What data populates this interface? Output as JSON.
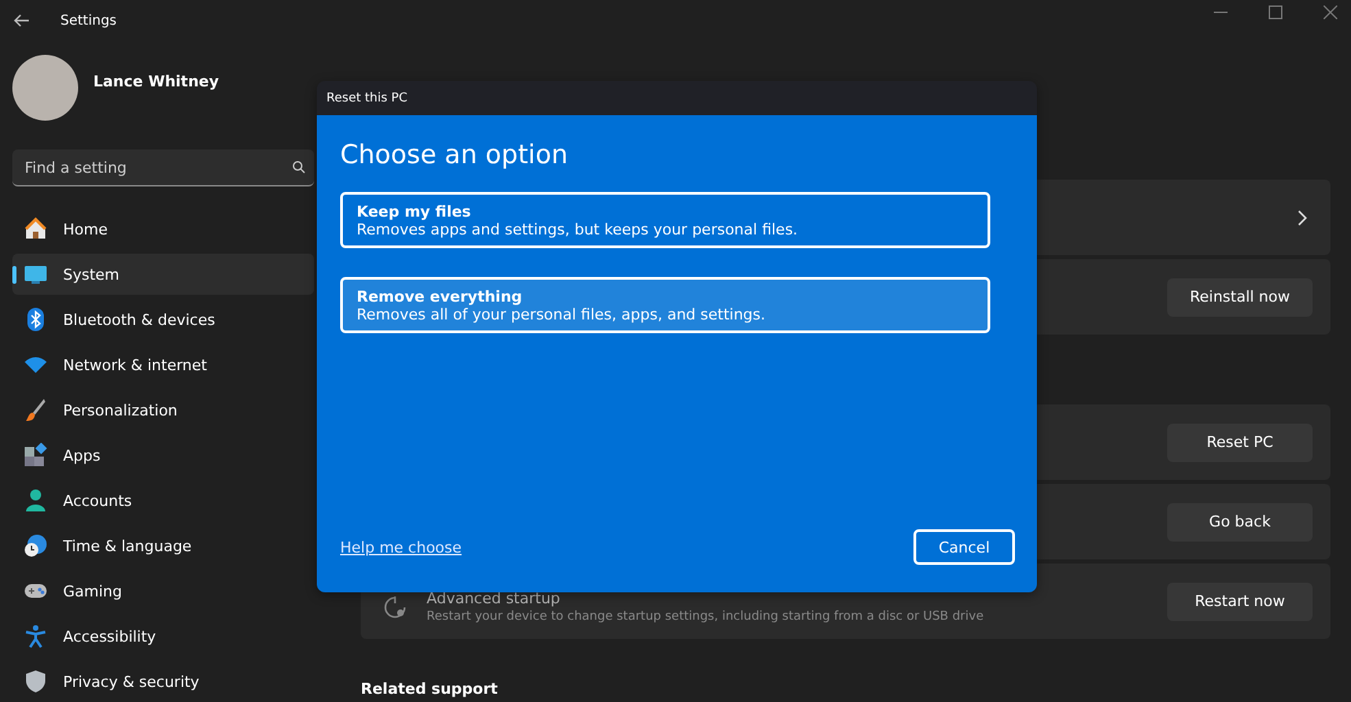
{
  "window": {
    "title": "Settings"
  },
  "profile": {
    "name": "Lance Whitney"
  },
  "search": {
    "placeholder": "Find a setting"
  },
  "nav": [
    {
      "label": "Home",
      "selected": false
    },
    {
      "label": "System",
      "selected": true
    },
    {
      "label": "Bluetooth & devices",
      "selected": false
    },
    {
      "label": "Network & internet",
      "selected": false
    },
    {
      "label": "Personalization",
      "selected": false
    },
    {
      "label": "Apps",
      "selected": false
    },
    {
      "label": "Accounts",
      "selected": false
    },
    {
      "label": "Time & language",
      "selected": false
    },
    {
      "label": "Gaming",
      "selected": false
    },
    {
      "label": "Accessibility",
      "selected": false
    },
    {
      "label": "Privacy & security",
      "selected": false
    }
  ],
  "cards": [
    {
      "kind": "link"
    },
    {
      "kind": "button",
      "button": "Reinstall now"
    },
    {
      "kind": "button",
      "button": "Reset PC"
    },
    {
      "kind": "button",
      "button": "Go back"
    },
    {
      "kind": "button",
      "title": "Advanced startup",
      "description": "Restart your device to change startup settings, including starting from a disc or USB drive",
      "button": "Restart now"
    }
  ],
  "related": {
    "title": "Related support"
  },
  "dialog": {
    "title": "Reset this PC",
    "heading": "Choose an option",
    "options": [
      {
        "title": "Keep my files",
        "description": "Removes apps and settings, but keeps your personal files.",
        "selected": false
      },
      {
        "title": "Remove everything",
        "description": "Removes all of your personal files, apps, and settings.",
        "selected": true
      }
    ],
    "link": "Help me choose",
    "cancel": "Cancel"
  }
}
